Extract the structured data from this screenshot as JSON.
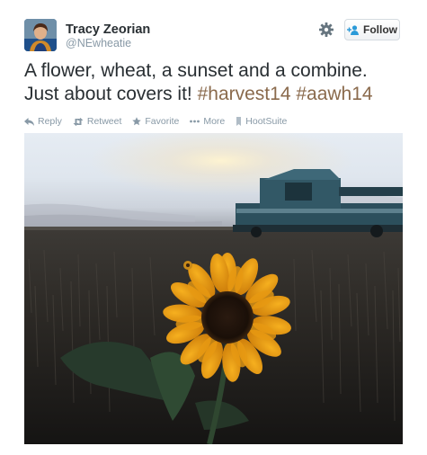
{
  "user": {
    "name": "Tracy Zeorian",
    "handle": "@NEwheatie"
  },
  "follow_button": {
    "label": "Follow"
  },
  "tweet": {
    "text_parts": [
      "A flower, wheat, a sunset and a combine.",
      "Just about covers it! "
    ],
    "hashtags": [
      "#harvest14",
      "#aawh14"
    ]
  },
  "actions": [
    {
      "label": "Reply",
      "icon": "reply-icon"
    },
    {
      "label": "Retweet",
      "icon": "retweet-icon"
    },
    {
      "label": "Favorite",
      "icon": "star-icon"
    },
    {
      "label": "More",
      "icon": "more-dots-icon"
    },
    {
      "label": "HootSuite",
      "icon": "hootsuite-icon"
    }
  ],
  "colors": {
    "hashtag": "#8a6a4c",
    "muted": "#8899a6",
    "text": "#292f33"
  }
}
